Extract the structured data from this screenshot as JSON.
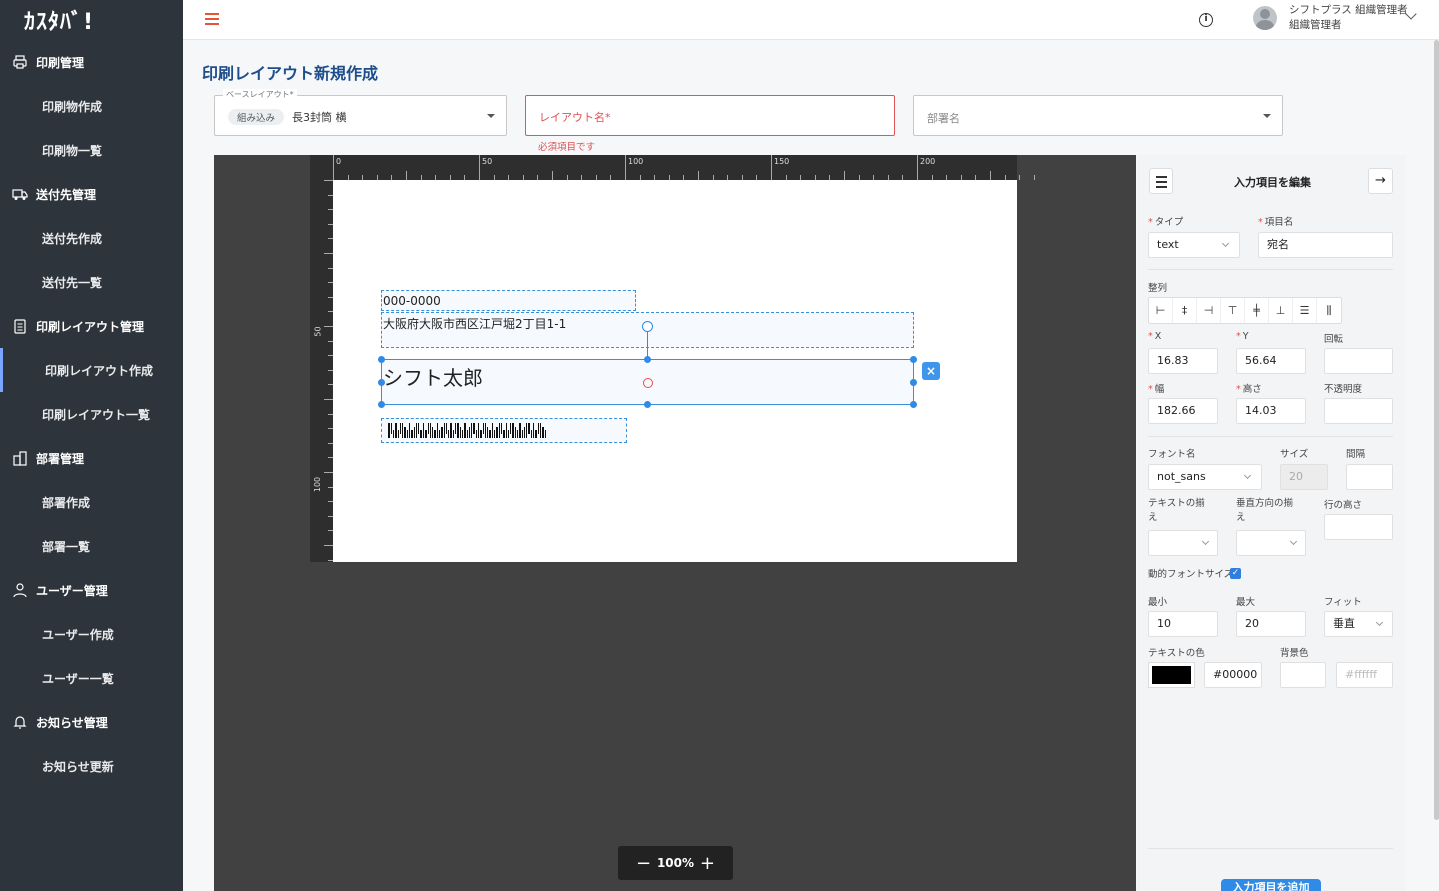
{
  "app": {
    "logo": "ｶｽﾀﾊﾞ!"
  },
  "sidebar": {
    "groups": [
      {
        "label": "印刷管理",
        "items": [
          "印刷物作成",
          "印刷物一覧"
        ]
      },
      {
        "label": "送付先管理",
        "items": [
          "送付先作成",
          "送付先一覧"
        ]
      },
      {
        "label": "印刷レイアウト管理",
        "items": [
          "印刷レイアウト作成",
          "印刷レイアウト一覧"
        ]
      },
      {
        "label": "部署管理",
        "items": [
          "部署作成",
          "部署一覧"
        ]
      },
      {
        "label": "ユーザー管理",
        "items": [
          "ユーザー作成",
          "ユーザー一覧"
        ]
      },
      {
        "label": "お知らせ管理",
        "items": [
          "お知らせ更新"
        ]
      }
    ],
    "active_item": "印刷レイアウト作成"
  },
  "header": {
    "user_line1": "シフトプラス 組織管理者",
    "user_line2": "組織管理者"
  },
  "page": {
    "title": "印刷レイアウト新規作成",
    "base_layout": {
      "legend": "ベースレイアウト*",
      "chip": "組み込み",
      "value": "長3封筒 横"
    },
    "layout_name": {
      "placeholder": "レイアウト名*",
      "error": "必須項目です"
    },
    "department": {
      "placeholder": "部署名"
    }
  },
  "canvas": {
    "ruler_top": [
      "0",
      "50",
      "100",
      "150",
      "200"
    ],
    "ruler_left": [
      "50",
      "100"
    ],
    "elements": {
      "zip": "000-0000",
      "address": "大阪府大阪市西区江戸堀2丁目1-1",
      "name": "シフト太郎"
    },
    "zoom": "100%",
    "zoom_out": "−",
    "zoom_in": "+",
    "delete_icon": "×"
  },
  "panel": {
    "title": "入力項目を編集",
    "type_label": "タイプ",
    "type_value": "text",
    "item_name_label": "項目名",
    "item_name_value": "宛名",
    "align_label": "整列",
    "x_label": "X",
    "x_value": "16.83",
    "y_label": "Y",
    "y_value": "56.64",
    "rotation_label": "回転",
    "rotation_value": "",
    "width_label": "幅",
    "width_value": "182.66",
    "height_label": "高さ",
    "height_value": "14.03",
    "opacity_label": "不透明度",
    "opacity_value": "",
    "font_label": "フォント名",
    "font_value": "not_sans",
    "size_label": "サイズ",
    "size_value": "20",
    "spacing_label": "間隔",
    "spacing_value": "",
    "text_align_label": "テキストの揃え",
    "vertical_align_label": "垂直方向の揃え",
    "line_height_label": "行の高さ",
    "dynamic_font_label": "動的フォントサイズ",
    "min_label": "最小",
    "min_value": "10",
    "max_label": "最大",
    "max_value": "20",
    "fit_label": "フィット",
    "fit_value": "垂直",
    "text_color_label": "テキストの色",
    "text_color_value": "#00000",
    "bg_color_label": "背景色",
    "bg_color_placeholder": "#ffffff",
    "add_button": "入力項目を追加"
  },
  "colors": {
    "sidebar": "#2d343b",
    "accent": "#2f8be5",
    "title": "#1d4d8a",
    "error": "#e05050"
  }
}
